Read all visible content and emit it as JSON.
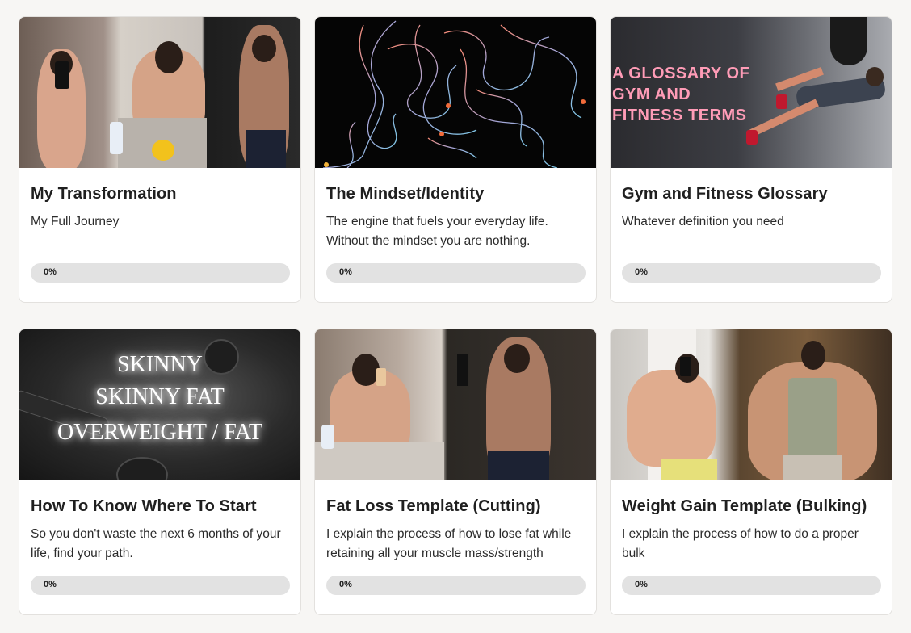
{
  "courses": [
    {
      "title": "My Transformation",
      "description": "My Full Journey",
      "progress_label": "0%",
      "progress": 0
    },
    {
      "title": "The Mindset/Identity",
      "description": "The engine that fuels your everyday life. Without the mindset you are nothing.",
      "progress_label": "0%",
      "progress": 0
    },
    {
      "title": "Gym and Fitness Glossary",
      "description": "Whatever definition you need",
      "progress_label": "0%",
      "progress": 0,
      "image_text": [
        "A GLOSSARY OF",
        "GYM AND",
        "FITNESS TERMS"
      ]
    },
    {
      "title": "How To Know Where To Start",
      "description": "So you don't waste the next 6 months of your life, find your path.",
      "progress_label": "0%",
      "progress": 0,
      "image_text": [
        "SKINNY",
        "SKINNY FAT",
        "OVERWEIGHT / FAT"
      ]
    },
    {
      "title": "Fat Loss Template (Cutting)",
      "description": "I explain the process of how to lose fat while retaining all your muscle mass/strength",
      "progress_label": "0%",
      "progress": 0
    },
    {
      "title": "Weight Gain Template (Bulking)",
      "description": "I explain the process of how to do a proper bulk",
      "progress_label": "0%",
      "progress": 0
    }
  ],
  "colors": {
    "page_background": "#f7f6f4",
    "card_background": "#ffffff",
    "progress_track": "#e2e2e2",
    "glossary_text": "#ff9cb7"
  }
}
